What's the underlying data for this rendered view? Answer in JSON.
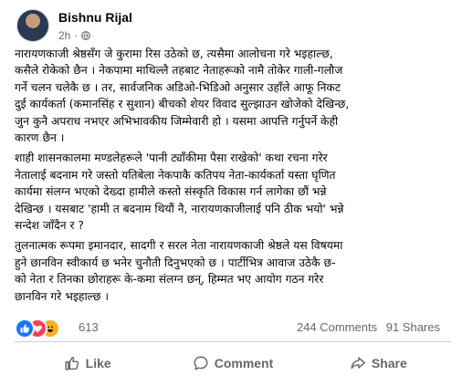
{
  "post": {
    "author": "Bishnu Rijal",
    "time": "2h",
    "paragraphs": [
      {
        "lines": [
          "नारायणकाजी श्रेष्ठसँग जे कुरामा रिस उठेको छ, त्यसैमा आलोचना गरे भइहाल्छ,",
          "कसैले रोकेको छैन । नेकपामा माथिल्लै तहबाट नेताहरूको नामै तोकेर गाली-गलौज",
          "गर्ने चलन चलेकै छ । तर, सार्वजनिक अडिओ-भिडिओ अनुसार उहाँले आफू निकट",
          "दुई कार्यकर्ता (कमानसिंह र सुशान) बीचको शेयर विवाद सुल्झाउन खोजेको देखिन्छ,",
          "जुन कुनै अपराध नभएर अभिभावकीय जिम्मेवारी हो । यसमा आपत्ति गर्नुपर्ने केही",
          "कारण छैन ।"
        ]
      },
      {
        "lines": [
          "शाही शासनकालमा मण्डलेहरूले 'पानी ट्याँकीमा पैसा राखेको' कथा रचना गरेर",
          "नेतालाई बदनाम गरे जस्तो यतिबेला नेकपाकै कतिपय नेता-कार्यकर्ता यस्ता घृणित",
          "कार्यमा संलग्न भएको देख्दा हामीले कस्तो संस्कृति विकास गर्न लागेका छौं भन्ने",
          "देखिन्छ । यसबाट 'हामी त बदनाम थियौं नै, नारायणकाजीलाई पनि ठीक भयो' भन्ने",
          "सन्देश जाँदैन र ?"
        ]
      },
      {
        "lines": [
          "तुलनात्मक रूपमा इमानदार, सादगी र सरल नेता नारायणकाजी श्रेष्ठले यस विषयमा",
          "हुने छानविन स्वीकार्य छ भनेर चुनौती दिनुभएको छ । पार्टीभित्र आवाज उठेकै छ-",
          "को नेता र तिनका छोराहरू के-कमा संलग्न छन्, हिम्मत भए आयोग गठन गरेर",
          "छानविन गरे भइहाल्छ ।"
        ]
      }
    ]
  },
  "reactions": {
    "icons": [
      "like-icon",
      "love-icon",
      "haha-icon"
    ],
    "count": "613",
    "comments": "244 Comments",
    "shares": "91 Shares"
  },
  "actions": {
    "like": "Like",
    "comment": "Comment",
    "share": "Share"
  },
  "colors": {
    "like_blue": "#1877f2",
    "love_red": "#f33e58",
    "haha_yellow": "#f7b125",
    "secondary_text": "#65676b"
  }
}
